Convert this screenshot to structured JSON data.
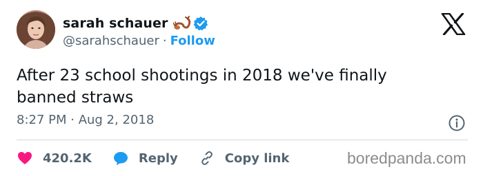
{
  "author": {
    "name": "sarah schauer",
    "handle": "@sarahschauer",
    "separator": "·",
    "follow_label": "Follow",
    "emoji_icon": "scorpion-icon",
    "verified_icon": "verified-badge-icon"
  },
  "tweet": {
    "line1": "After 23 school shootings in 2018 we've finally",
    "line2": "banned straws",
    "timestamp": "8:27 PM · Aug 2, 2018"
  },
  "actions": {
    "likes": "420.2K",
    "reply_label": "Reply",
    "copy_label": "Copy link"
  },
  "watermark": "boredpanda.com",
  "colors": {
    "accent": "#1d9bf0",
    "like": "#f91880",
    "secondary_text": "#536471",
    "divider": "#cfd9de"
  }
}
